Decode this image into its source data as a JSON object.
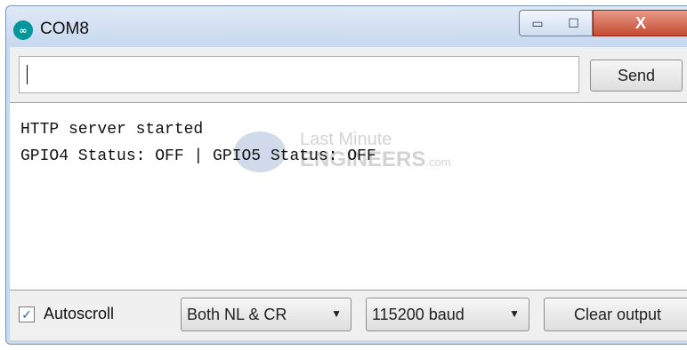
{
  "window": {
    "title": "COM8",
    "icon": "arduino-icon",
    "icon_glyph": "∞",
    "minimize_glyph": "▭",
    "maximize_glyph": "☐",
    "close_glyph": "X"
  },
  "serial": {
    "input_value": "",
    "send_label": "Send"
  },
  "output": {
    "lines": [
      "HTTP server started",
      "GPIO4 Status: OFF | GPIO5 Status: OFF"
    ]
  },
  "watermark": {
    "line1": "Last Minute",
    "line2": "ENGINEERS",
    "suffix": ".com"
  },
  "bottom": {
    "autoscroll_checked": true,
    "check_glyph": "✓",
    "autoscroll_label": "Autoscroll",
    "line_ending": "Both NL & CR",
    "baud": "115200 baud",
    "dropdown_arrow": "▼",
    "clear_label": "Clear output"
  }
}
